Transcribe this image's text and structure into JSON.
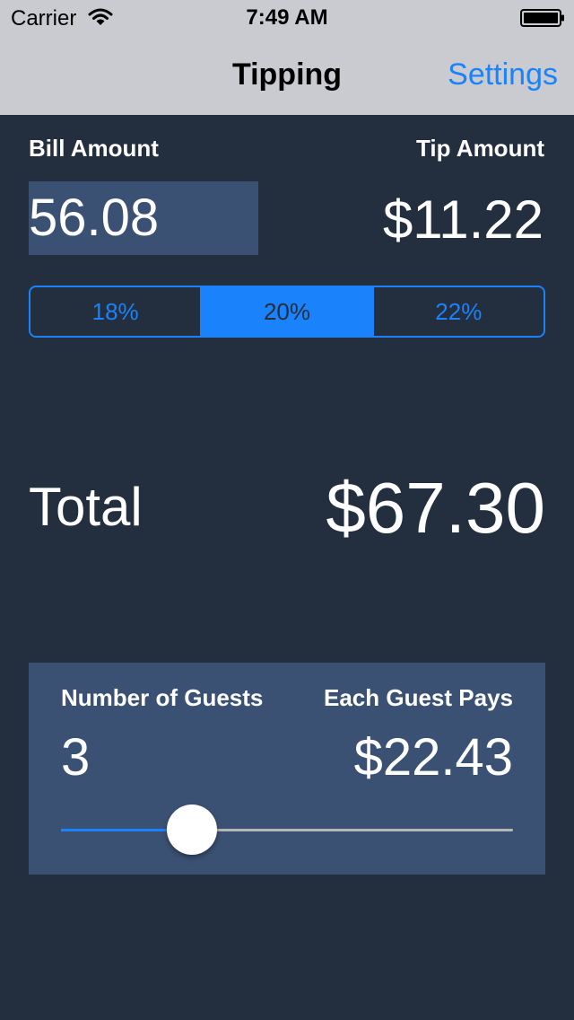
{
  "status_bar": {
    "carrier": "Carrier",
    "time": "7:49 AM"
  },
  "nav": {
    "title": "Tipping",
    "settings_label": "Settings"
  },
  "bill": {
    "label": "Bill Amount",
    "value": "56.08"
  },
  "tip": {
    "label": "Tip Amount",
    "value": "$11.22"
  },
  "tip_options": {
    "segments": [
      "18%",
      "20%",
      "22%"
    ],
    "selected_index": 1
  },
  "total": {
    "label": "Total",
    "value": "$67.30"
  },
  "guests": {
    "count_label": "Number of Guests",
    "count_value": "3",
    "each_label": "Each Guest Pays",
    "each_value": "$22.43",
    "slider_fraction": 0.29
  },
  "colors": {
    "background": "#232f3e",
    "panel": "#3b5173",
    "accent": "#1a82fb",
    "nav_bar": "#c9cbd1"
  },
  "icons": {
    "wifi": "wifi-icon",
    "battery": "battery-icon"
  }
}
